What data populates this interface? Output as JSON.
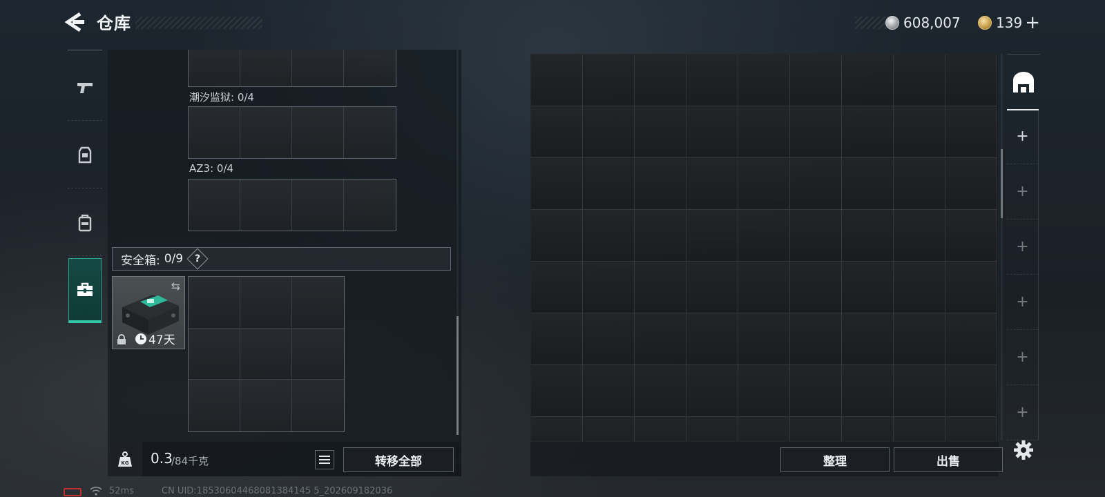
{
  "header": {
    "title": "仓库",
    "currency_silver": "608,007",
    "currency_gold": "139",
    "gold_plus": "+"
  },
  "left_tabs": [
    {
      "name": "weapons",
      "icon": "pistol-icon"
    },
    {
      "name": "armor",
      "icon": "vest-icon"
    },
    {
      "name": "backpack",
      "icon": "backpack-icon"
    },
    {
      "name": "safebox",
      "icon": "toolbox-icon",
      "active": true
    }
  ],
  "containers": [
    {
      "label": "潮汐监狱: 0/4"
    },
    {
      "label": "AZ3: 0/4"
    }
  ],
  "safebox": {
    "label": "安全箱:",
    "count": "0/9",
    "help": "?",
    "item_time": "47天"
  },
  "weight": {
    "value": "0.3",
    "max": "/84千克",
    "icon_label": "KG"
  },
  "buttons": {
    "transfer_all": "转移全部",
    "organize": "整理",
    "sell": "出售"
  },
  "status_bar": {
    "ping": "52ms",
    "uid": "CN UID:18530604468081384145 5_202609182036"
  },
  "colors": {
    "accent": "#31c9a7",
    "battery_low": "#c0312f"
  }
}
